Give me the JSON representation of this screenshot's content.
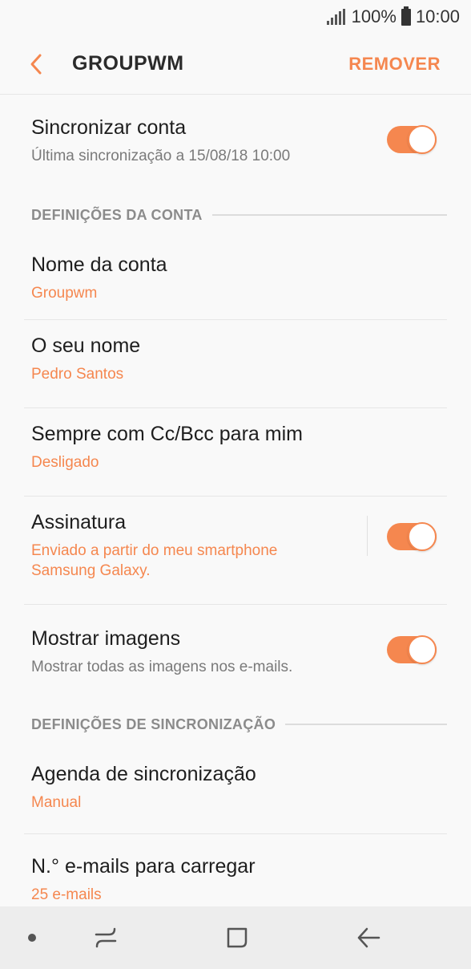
{
  "status_bar": {
    "battery": "100%",
    "time": "10:00"
  },
  "app_bar": {
    "title": "GROUPWM",
    "action": "REMOVER"
  },
  "sync_account": {
    "label": "Sincronizar conta",
    "sub": "Última sincronização a 15/08/18  10:00",
    "enabled": true
  },
  "section_account": {
    "title": "DEFINIÇÕES DA CONTA"
  },
  "account_name": {
    "label": "Nome da conta",
    "value": "Groupwm"
  },
  "your_name": {
    "label": "O seu nome",
    "value": "Pedro Santos"
  },
  "cc_bcc": {
    "label": "Sempre com Cc/Bcc para mim",
    "value": "Desligado"
  },
  "signature": {
    "label": "Assinatura",
    "value": "Enviado a partir do meu smartphone Samsung Galaxy.",
    "enabled": true
  },
  "show_images": {
    "label": "Mostrar imagens",
    "sub": "Mostrar todas as imagens nos e-mails.",
    "enabled": true
  },
  "section_sync": {
    "title": "DEFINIÇÕES DE SINCRONIZAÇÃO"
  },
  "sync_schedule": {
    "label": "Agenda de sincronização",
    "value": "Manual"
  },
  "emails_to_load": {
    "label": "N.° e-mails para carregar",
    "value": "25 e-mails"
  },
  "colors": {
    "accent": "#f5874f",
    "background": "#f9f9f9",
    "navbar": "#ededed"
  },
  "icons": {
    "back": "chevron-left-icon",
    "nav_dot": "dot-icon",
    "nav_recents": "recents-icon",
    "nav_home": "home-square-icon",
    "nav_back": "arrow-left-icon"
  }
}
